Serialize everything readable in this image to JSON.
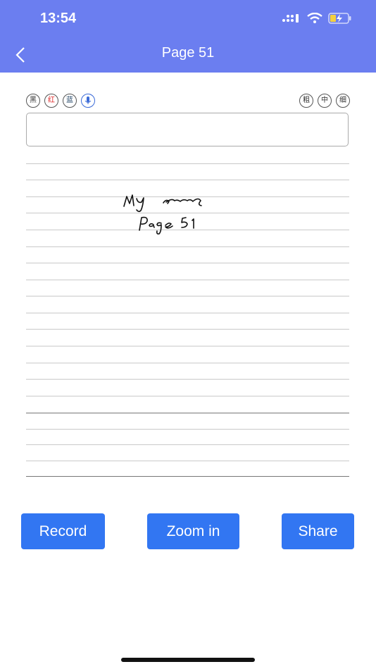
{
  "status_bar": {
    "time": "13:54"
  },
  "nav": {
    "title": "Page 51"
  },
  "pen_options": {
    "colors": [
      "黑",
      "红",
      "蓝"
    ],
    "widths": [
      "粗",
      "中",
      "细"
    ]
  },
  "note": {
    "handwriting_lines": [
      "My notes",
      "Page 51"
    ]
  },
  "actions": {
    "record": "Record",
    "zoom": "Zoom in",
    "share": "Share"
  },
  "colors": {
    "header_bg": "#6b7ef0",
    "button_bg": "#3276f2"
  }
}
